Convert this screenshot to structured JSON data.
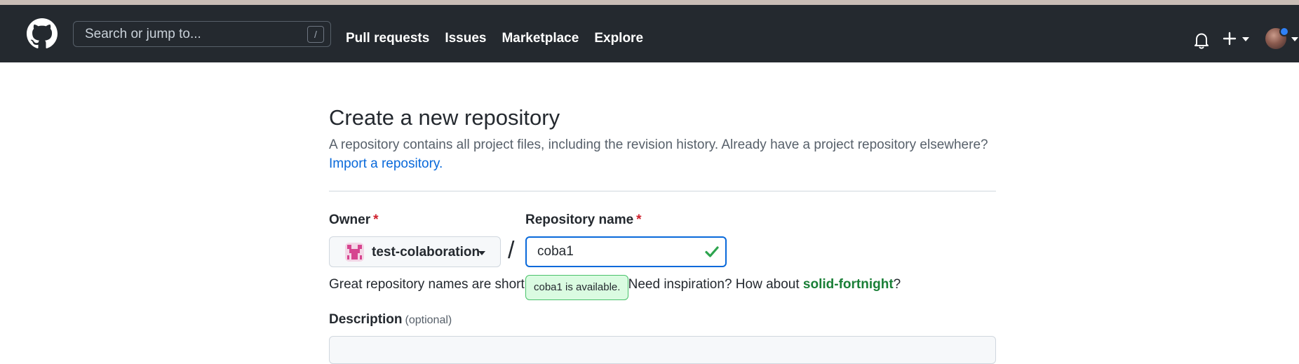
{
  "header": {
    "search_placeholder": "Search or jump to...",
    "search_shortcut": "/",
    "nav": [
      {
        "label": "Pull requests"
      },
      {
        "label": "Issues"
      },
      {
        "label": "Marketplace"
      },
      {
        "label": "Explore"
      }
    ],
    "icons": {
      "logo": "github-logo-icon",
      "notifications": "bell-icon",
      "create": "plus-icon",
      "avatar": "user-avatar"
    }
  },
  "page": {
    "title": "Create a new repository",
    "subtitle": "A repository contains all project files, including the revision history. Already have a project repository elsewhere?",
    "import_link": "Import a repository."
  },
  "form": {
    "owner_label": "Owner",
    "owner_required": "*",
    "owner_value": "test-colaboration",
    "separator": "/",
    "repo_label": "Repository name",
    "repo_required": "*",
    "repo_value": "coba1",
    "availability_tooltip": "coba1 is available.",
    "hint_prefix": "Great repository names are short and memorable. Need inspiration? How about ",
    "hint_suggestion": "solid-fortnight",
    "hint_suffix": "?",
    "description_label": "Description",
    "description_optional": "(optional)"
  },
  "colors": {
    "header_bg": "#24292f",
    "link": "#0969da",
    "success": "#1a7f37",
    "required": "#cf222e",
    "focus_border": "#0969da"
  }
}
